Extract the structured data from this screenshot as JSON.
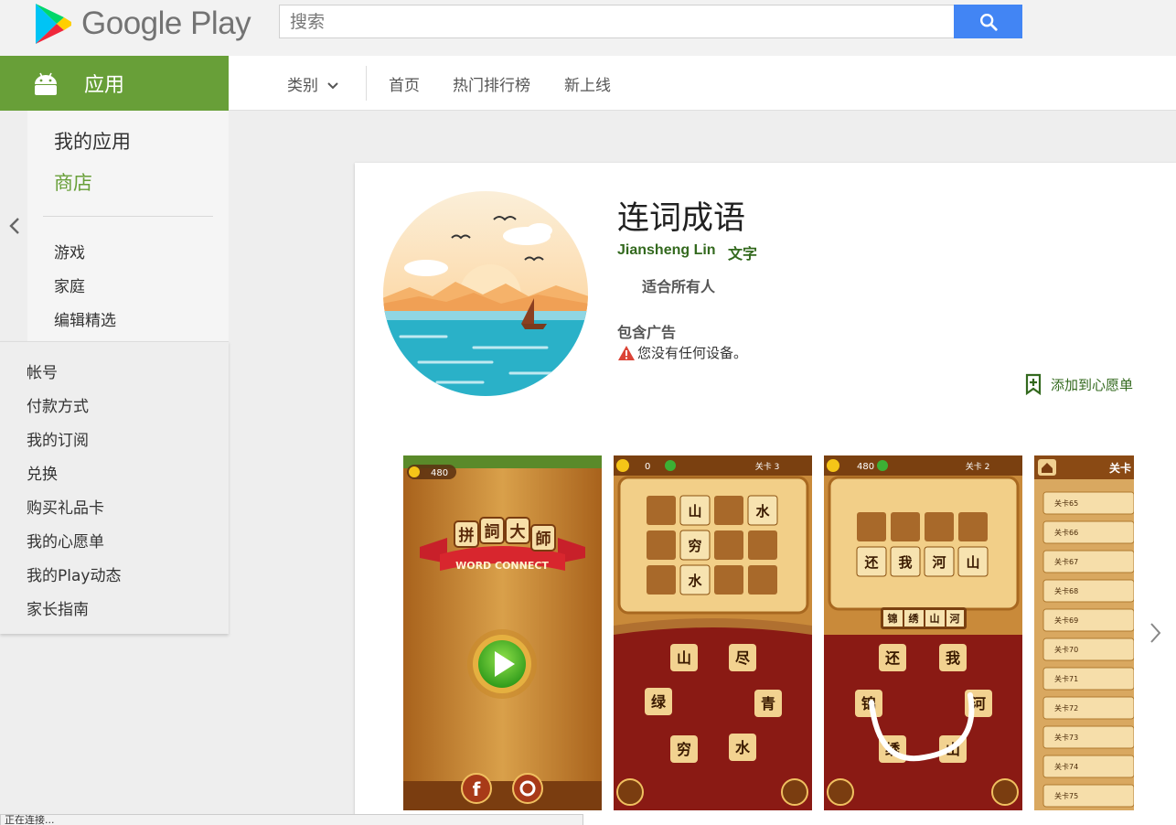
{
  "header": {
    "logo_text": "Google Play",
    "search_placeholder": "搜索"
  },
  "category_bar": {
    "apps_label": "应用",
    "categories_label": "类别",
    "nav": [
      "首页",
      "热门排行榜",
      "新上线"
    ]
  },
  "sidebar": {
    "my_apps": "我的应用",
    "store": "商店",
    "sub_items": [
      "游戏",
      "家庭",
      "编辑精选"
    ]
  },
  "account_menu": {
    "items": [
      "帐号",
      "付款方式",
      "我的订阅",
      "兑换",
      "购买礼品卡",
      "我的心愿单",
      "我的Play动态",
      "家长指南"
    ]
  },
  "app": {
    "title": "连词成语",
    "developer": "Jiansheng Lin",
    "genre": "文字",
    "content_rating": "适合所有人",
    "ads_notice": "包含广告",
    "device_warning": "您没有任何设备。",
    "wishlist_label": "添加到心愿单"
  },
  "screenshots": {
    "shot1": {
      "coins": "480",
      "game_title_chars": [
        "拼",
        "詞",
        "大",
        "師"
      ],
      "ribbon_text": "WORD CONNECT"
    },
    "shot2": {
      "coins": "0",
      "level": "关卡 3",
      "grid": [
        "",
        "山",
        "",
        "水",
        "",
        "穷",
        "",
        "",
        "",
        "水",
        "",
        ""
      ],
      "letters": [
        "山",
        "尽",
        "绿",
        "青",
        "穷",
        "水"
      ]
    },
    "shot3": {
      "coins": "480",
      "level": "关卡 2",
      "answer": [
        "还",
        "我",
        "河",
        "山"
      ],
      "hint": [
        "锦",
        "绣",
        "山",
        "河"
      ],
      "letters": [
        "还",
        "我",
        "锦",
        "河",
        "绣",
        "山"
      ]
    },
    "shot4": {
      "header": "关卡",
      "levels": [
        "关卡65",
        "关卡66",
        "关卡67",
        "关卡68",
        "关卡69",
        "关卡70",
        "关卡71",
        "关卡72",
        "关卡73",
        "关卡74",
        "关卡75"
      ]
    }
  },
  "status_text": "正在连接..."
}
